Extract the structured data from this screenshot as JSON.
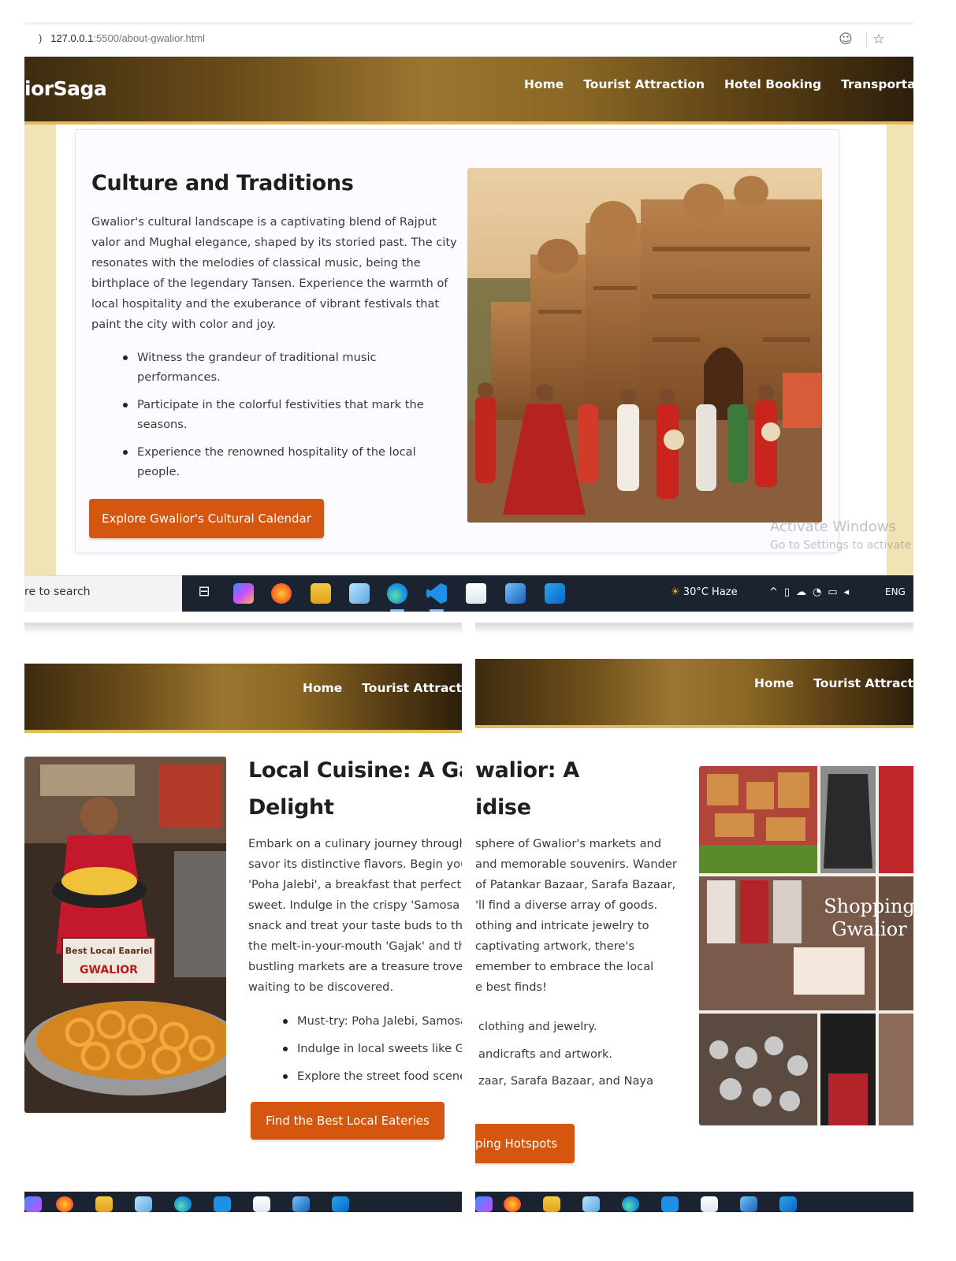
{
  "browser": {
    "url_host": "127.0.0.1",
    "url_path": ":5500/about-gwalior.html",
    "url_prefix": ")"
  },
  "site": {
    "brand": "iorSaga",
    "nav": [
      "Home",
      "Tourist Attraction",
      "Hotel Booking",
      "Transportation"
    ]
  },
  "culture": {
    "title": "Culture and Traditions",
    "paragraph_lines": [
      "Gwalior's cultural landscape is a captivating blend of Rajput",
      "valor and Mughal elegance, shaped by its storied past. The city",
      "resonates with the melodies of classical music, being the",
      "birthplace of the legendary Tansen. Experience the warmth of",
      "local hospitality and the exuberance of vibrant festivals that",
      "paint the city with color and joy."
    ],
    "bullets": [
      [
        "Witness the grandeur of traditional music",
        "performances."
      ],
      [
        "Participate in the colorful festivities that mark the",
        "seasons."
      ],
      [
        "Experience the renowned hospitality of the local",
        "people."
      ]
    ],
    "button": "Explore Gwalior's Cultural Calendar",
    "image_icon": "fort-festival-photo"
  },
  "watermark": {
    "line1": "Activate Windows",
    "line2": "Go to Settings to activate V"
  },
  "taskbar": {
    "search": "re to search",
    "weather": "30°C  Haze",
    "lang": "ENG",
    "icons": [
      "task-view-icon",
      "copilot-icon",
      "firefox-icon",
      "file-explorer-icon",
      "notepad-icon",
      "edge-icon",
      "vscode-icon",
      "store-icon",
      "terminal-icon",
      "outlook-icon"
    ]
  },
  "cuisine": {
    "nav": [
      "Home",
      "Tourist Attraction"
    ],
    "title_lines": [
      "Local Cuisine: A Gas",
      "Delight"
    ],
    "paragraph_lines": [
      "Embark on a culinary journey through",
      "savor its distinctive flavors. Begin your",
      "'Poha Jalebi', a breakfast that perfectly",
      "sweet. Indulge in the crispy 'Samosa K",
      "snack and treat your taste buds to the",
      "the melt-in-your-mouth 'Gajak' and th",
      "bustling markets are a treasure trove",
      "waiting to be discovered."
    ],
    "bullets": [
      "Must-try: Poha Jalebi, Samosa",
      "Indulge in local sweets like G",
      "Explore the street food scene"
    ],
    "button": "Find the Best Local Eateries",
    "image_sign1": "Best Local Eaariel",
    "image_sign2": "GWALIOR"
  },
  "shopping": {
    "nav": [
      "Home",
      "Tourist Attractio"
    ],
    "title_lines": [
      "walior: A",
      "idise"
    ],
    "paragraph_lines": [
      "sphere of Gwalior's markets and",
      "and memorable souvenirs. Wander",
      "of Patankar Bazaar, Sarafa Bazaar,",
      "'ll find a diverse array of goods.",
      "othing and intricate jewelry to",
      "captivating artwork, there's",
      "emember to embrace the local",
      "e best finds!"
    ],
    "bullets": [
      "clothing and jewelry.",
      "andicrafts and artwork.",
      "zaar, Sarafa Bazaar, and Naya"
    ],
    "button": "ping Hotspots",
    "image_caption_1": "Shopping",
    "image_caption_2": "Gwalior"
  },
  "colors": {
    "accent_button": "#d4560f",
    "nav_gold": "#e7b85a",
    "page_beige": "#f1e4b4"
  }
}
